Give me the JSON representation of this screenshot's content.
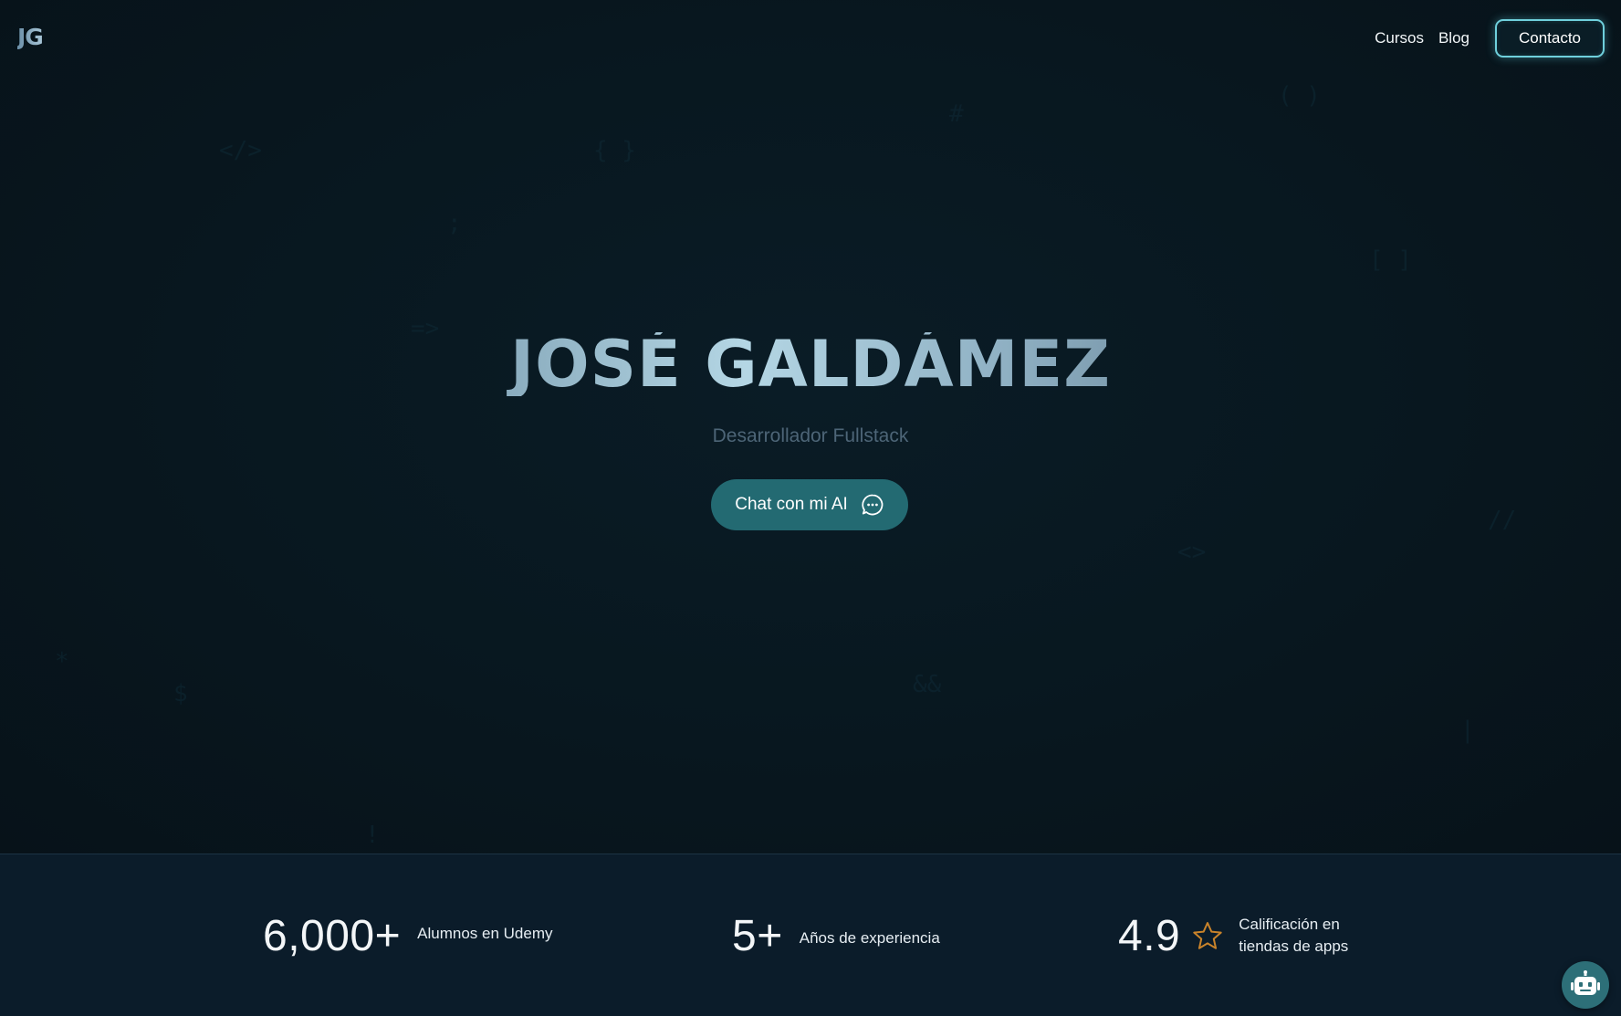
{
  "nav": {
    "logo": "JG",
    "links": [
      "Cursos",
      "Blog"
    ],
    "contact_label": "Contacto"
  },
  "hero": {
    "title": "JOSÉ GALDÁMEZ",
    "subtitle": "Desarrollador Fullstack",
    "chat_button_label": "Chat con mi AI",
    "chat_icon": "chat-bubble-icon"
  },
  "stats": [
    {
      "value": "6,000+",
      "label": "Alumnos en Udemy"
    },
    {
      "value": "5+",
      "label": "Años de experiencia"
    },
    {
      "value": "4.9",
      "label": "Calificación en tiendas de apps",
      "icon": "star-icon"
    }
  ],
  "bot": {
    "icon": "robot-icon"
  },
  "colors": {
    "background": "#081821",
    "accent": "#236a72",
    "contact_border": "#6fd0dc",
    "star": "#c9832a",
    "stats_background": "#0b1c2a"
  }
}
